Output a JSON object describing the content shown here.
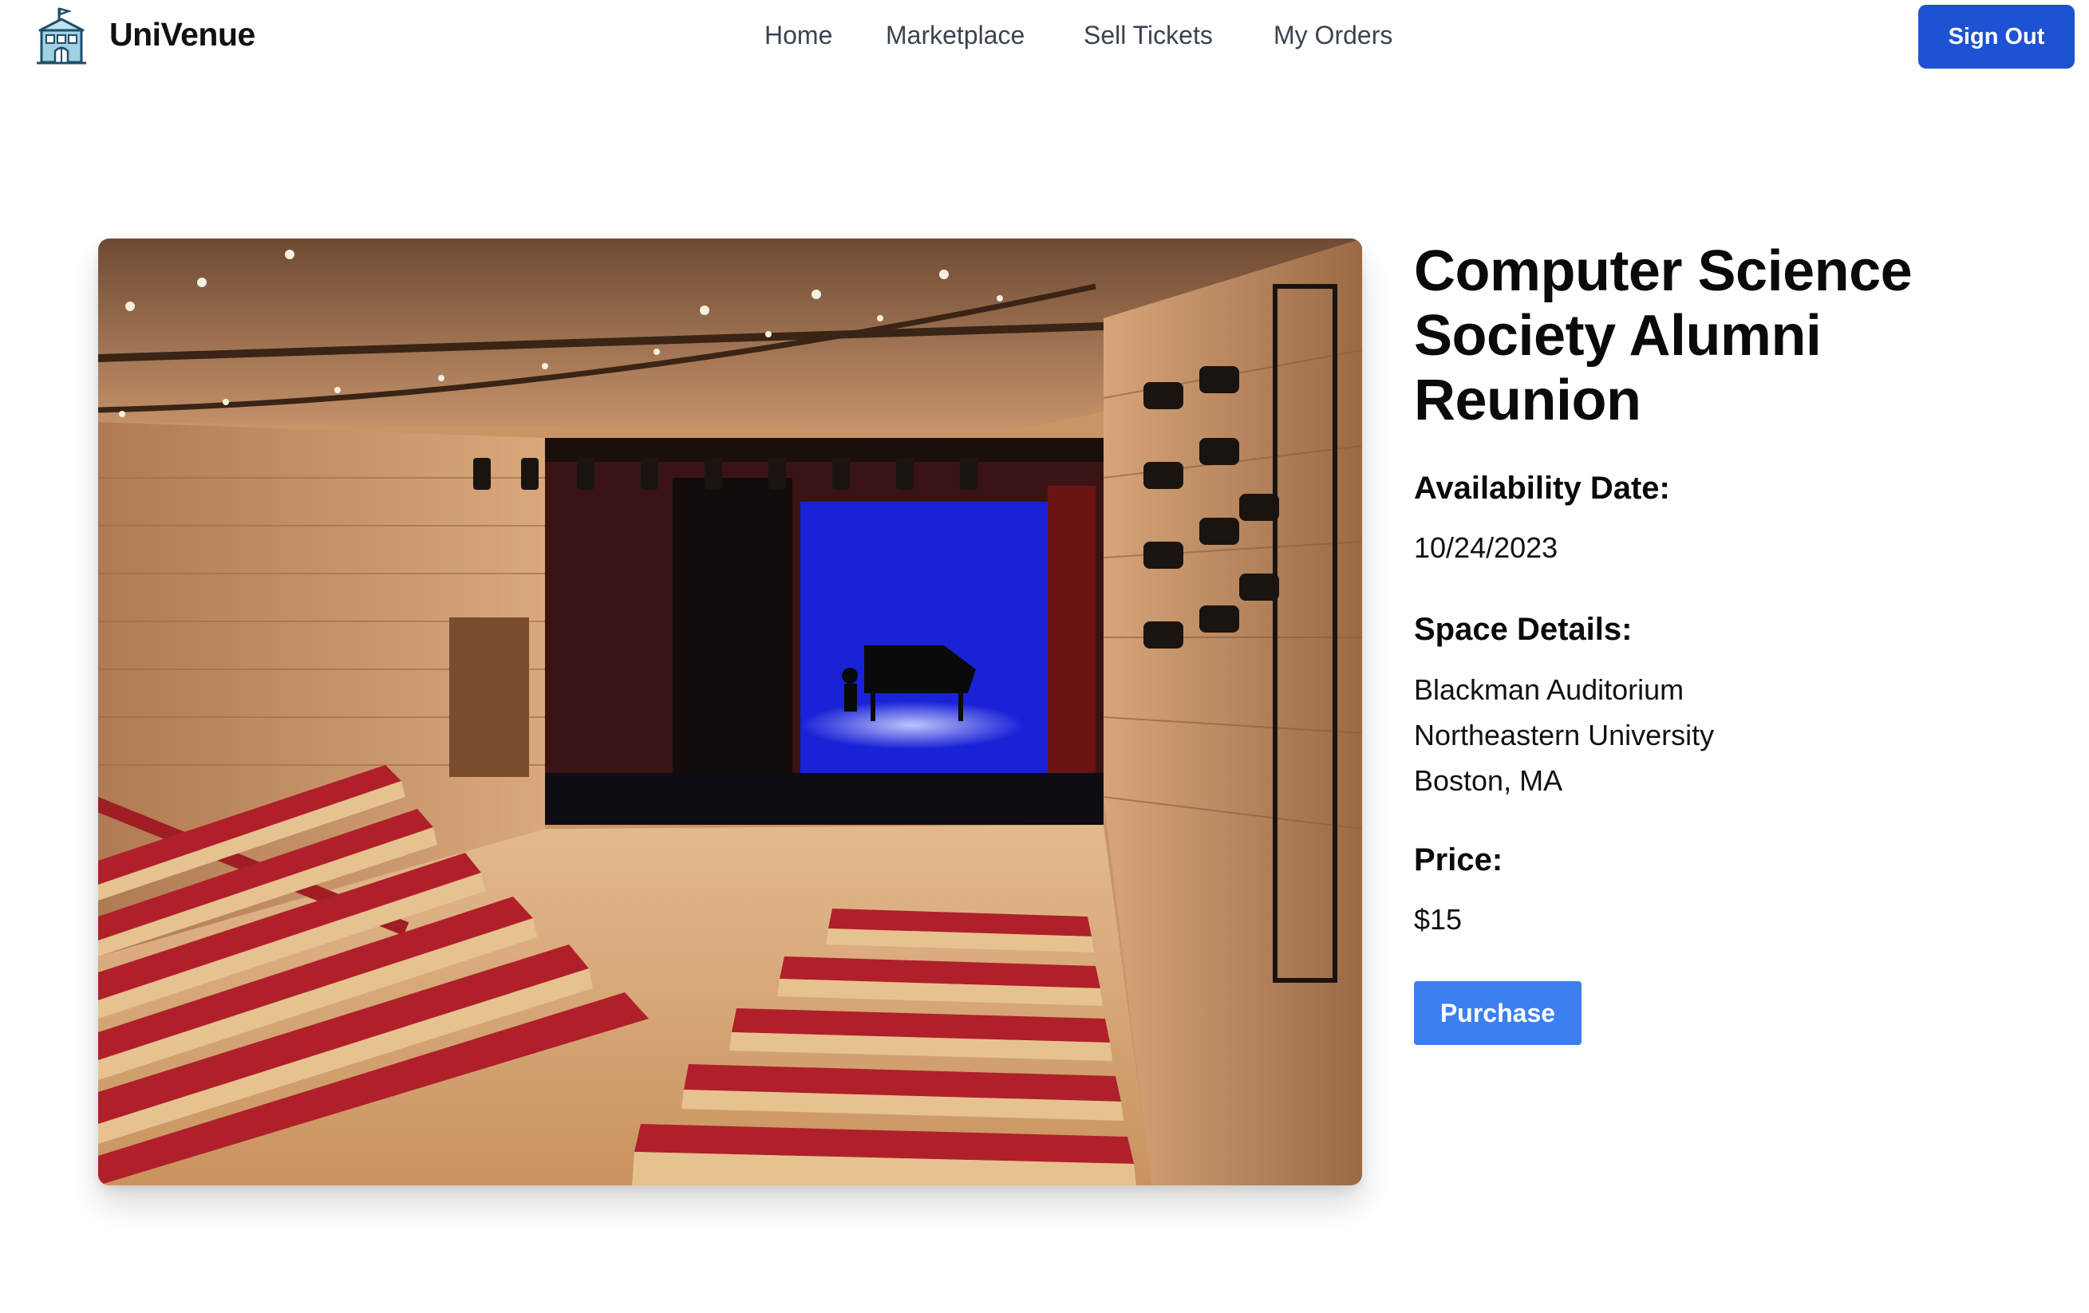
{
  "header": {
    "brand": "UniVenue",
    "logo_icon": "school-building-icon",
    "nav": [
      "Home",
      "Marketplace",
      "Sell Tickets",
      "My Orders"
    ],
    "sign_out_label": "Sign Out"
  },
  "event": {
    "title": "Computer Science Society Alumni Reunion",
    "image_icon": "auditorium-photo",
    "availability_label": "Availability Date:",
    "availability_date": "10/24/2023",
    "space_label": "Space Details:",
    "space_lines": [
      "Blackman Auditorium",
      "Northeastern University",
      "Boston, MA"
    ],
    "price_label": "Price:",
    "price": "$15",
    "purchase_label": "Purchase"
  },
  "colors": {
    "primary": "#1d52d3",
    "purchase": "#3d7ff0",
    "nav_text": "#3b4352"
  }
}
